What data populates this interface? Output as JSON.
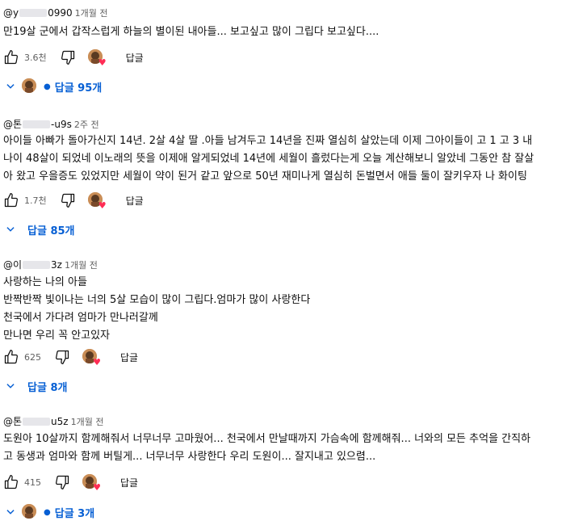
{
  "comments": [
    {
      "author_prefix": "@y",
      "author_suffix": "0990",
      "time": "1개월 전",
      "lines": [
        "만19살 군에서 갑작스럽게 하늘의 별이된 내아들... 보고싶고 많이 그립다 보고싶다...."
      ],
      "likes": "3.6천",
      "reply_label": "답글",
      "replies_label": "답글 95개",
      "replies_show_avatar": true
    },
    {
      "author_prefix": "@톤",
      "author_suffix": "-u9s",
      "time": "2주 전",
      "lines": [
        "아이들 아빠가 돌아가신지 14년. 2살 4살 딸 .아들  남겨두고 14년을 진짜 열심히 살았는데 이제 그아이들이 고 1 고 3  내",
        "나이 48살이 되었네 이노래의 뜻을 이제애 알게되었네 14년에 세월이 흘렀다는게 오늘 계산해보니 알았네 그동안 참 잘살",
        "아 왔고 우을증도 있었지만 세월이 약이 된거 같고 앞으로 50년 재미나게 열심히 돈벌면서 애들 둘이 잘키우자  나 화이팅"
      ],
      "likes": "1.7천",
      "reply_label": "답글",
      "replies_label": "답글 85개",
      "replies_show_avatar": false
    },
    {
      "author_prefix": "@이",
      "author_suffix": "3z",
      "time": "1개월 전",
      "lines": [
        "사랑하는 나의 아들",
        "반짝반짝 빛이나는 너의 5살 모습이 많이 그립다.엄마가 많이 사랑한다",
        "천국에서 가다려 엄마가 만나러갈께",
        "만나면 우리 꼭 안고있자"
      ],
      "likes": "625",
      "reply_label": "답글",
      "replies_label": "답글 8개",
      "replies_show_avatar": false
    },
    {
      "author_prefix": "@톤",
      "author_suffix": "u5z",
      "time": "1개월 전",
      "lines": [
        "도원아 10살까지 함께해줘서 너무너무 고마웠어... 천국에서 만날때까지 가슴속에 함께해줘... 너와의 모든 추억을 간직하",
        "고 동생과 엄마와 함께 버틸게... 너무너무 사랑한다 우리 도원이... 잘지내고 있으렴..."
      ],
      "likes": "415",
      "reply_label": "답글",
      "replies_label": "답글 3개",
      "replies_show_avatar": true
    }
  ],
  "icons": {
    "like": "thumbs-up-icon",
    "dislike": "thumbs-down-icon",
    "heart": "heart-icon",
    "expand": "chevron-down-icon"
  },
  "colors": {
    "link": "#065fd4",
    "heart": "#ff2d55",
    "meta": "#606060"
  }
}
